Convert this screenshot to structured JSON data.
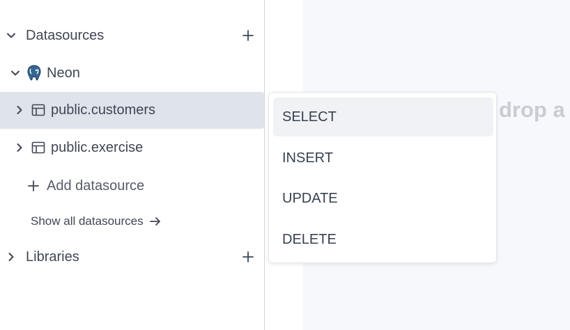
{
  "sidebar": {
    "datasources_title": "Datasources",
    "connection_name": "Neon",
    "tables": [
      {
        "label": "public.customers"
      },
      {
        "label": "public.exercise"
      }
    ],
    "add_datasource_label": "Add datasource",
    "show_all_label": "Show all datasources",
    "libraries_title": "Libraries"
  },
  "canvas": {
    "hint_text": "drop a"
  },
  "context_menu": {
    "items": [
      {
        "label": "SELECT"
      },
      {
        "label": "INSERT"
      },
      {
        "label": "UPDATE"
      },
      {
        "label": "DELETE"
      }
    ]
  },
  "colors": {
    "selected_row": "#dfe3ea",
    "menu_hover": "#f0f2f5",
    "text": "#3f4654"
  },
  "icons": {
    "datasources_toggle": "chevron-down-icon",
    "connection": "postgres-elephant-icon",
    "table": "table-icon",
    "add": "plus-icon",
    "arrow": "arrow-right-icon"
  }
}
